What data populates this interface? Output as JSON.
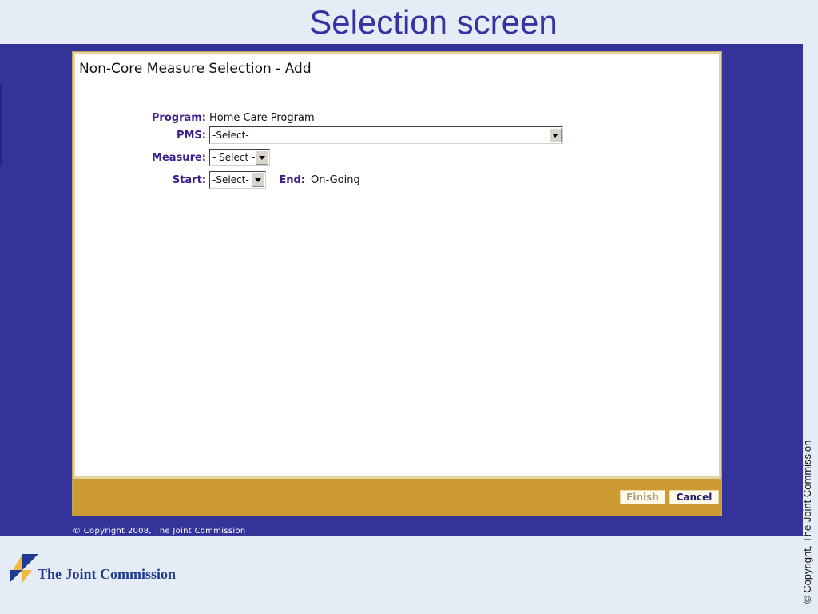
{
  "slide": {
    "title": "Selection screen"
  },
  "window": {
    "title": "Non-Core Measure Selection - Add"
  },
  "form": {
    "program_label": "Program:",
    "program_value": "Home Care Program",
    "pms_label": "PMS:",
    "pms_selected": "-Select-",
    "measure_label": "Measure:",
    "measure_selected": "- Select -",
    "start_label": "Start:",
    "start_selected": "-Select-",
    "end_label": "End:",
    "end_value": "On-Going"
  },
  "footer": {
    "finish_label": "Finish",
    "cancel_label": "Cancel"
  },
  "page_copyright": "© Copyright 2008, The Joint Commission",
  "logo": {
    "text": "The Joint Commission",
    "icon": "joint-commission-logo-icon"
  },
  "side_copyright": "© Copyright, The Joint Commission",
  "colors": {
    "slide_title": "#3333a3",
    "panel_blue": "#333399",
    "footer_gold": "#cc9933",
    "label_purple": "#3a1f8f",
    "slide_background": "#e6ecf6"
  }
}
